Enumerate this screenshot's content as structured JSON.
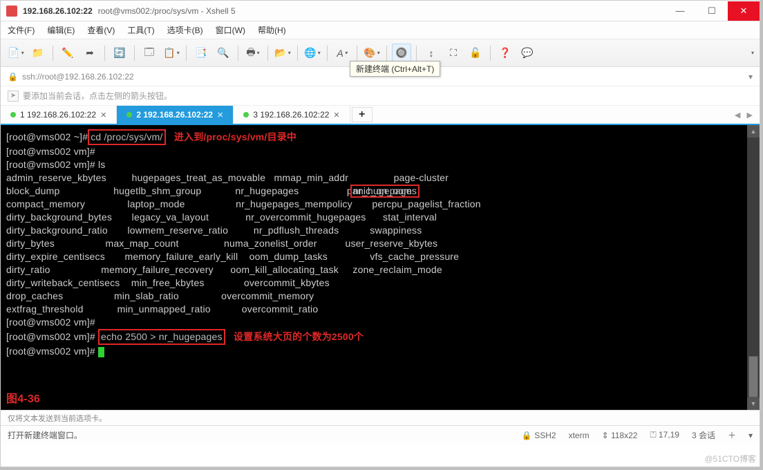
{
  "title": {
    "host": "192.168.26.102:22",
    "path": "root@vms002:/proc/sys/vm - Xshell 5"
  },
  "menu": {
    "file": "文件(F)",
    "edit": "编辑(E)",
    "view": "查看(V)",
    "tools": "工具(T)",
    "tabs": "选项卡(B)",
    "window": "窗口(W)",
    "help": "帮助(H)"
  },
  "tooltip": "新建终端 (Ctrl+Alt+T)",
  "addr": {
    "url": "ssh://root@192.168.26.102:22"
  },
  "hint": "要添加当前会话，点击左侧的箭头按钮。",
  "tabs": [
    {
      "label": "1 192.168.26.102:22",
      "active": false
    },
    {
      "label": "2 192.168.26.102:22",
      "active": true
    },
    {
      "label": "3 192.168.26.102:22",
      "active": false
    }
  ],
  "term": {
    "line1_prompt": "[root@vms002 ~]#",
    "line1_cmd": " cd /proc/sys/vm/ ",
    "ann1": "进入到/proc/sys/vm/目录中",
    "line2": "[root@vms002 vm]#",
    "line3": "[root@vms002 vm]# ls",
    "listing": "admin_reserve_kbytes         hugepages_treat_as_movable   mmap_min_addr                page-cluster\nblock_dump                   hugetlb_shm_group            nr_hugepages                 panic_on_oom\ncompact_memory               laptop_mode                  nr_hugepages_mempolicy       percpu_pagelist_fraction\ndirty_background_bytes       legacy_va_layout             nr_overcommit_hugepages      stat_interval\ndirty_background_ratio       lowmem_reserve_ratio         nr_pdflush_threads           swappiness\ndirty_bytes                  max_map_count                numa_zonelist_order          user_reserve_kbytes\ndirty_expire_centisecs       memory_failure_early_kill    oom_dump_tasks               vfs_cache_pressure\ndirty_ratio                  memory_failure_recovery      oom_kill_allocating_task     zone_reclaim_mode\ndirty_writeback_centisecs    min_free_kbytes              overcommit_kbytes\ndrop_caches                  min_slab_ratio               overcommit_memory\nextfrag_threshold            min_unmapped_ratio           overcommit_ratio",
    "line4": "[root@vms002 vm]#",
    "line5_cmd": "echo 2500 > nr_hugepages",
    "ann2": "设置系统大页的个数为2500个",
    "line6": "[root@vms002 vm]# ",
    "fig": "图4-36"
  },
  "smallstatus": "仅将文本发送到当前选项卡。",
  "status": {
    "left": "打开新建终端窗口。",
    "ssh": "SSH2",
    "term": "xterm",
    "size": "118x22",
    "pos": "17,19",
    "sess": "3 会话"
  },
  "watermark": "@51CTO博客",
  "icons": {
    "lock": "🔒",
    "add": "+",
    "plus": "＋"
  }
}
